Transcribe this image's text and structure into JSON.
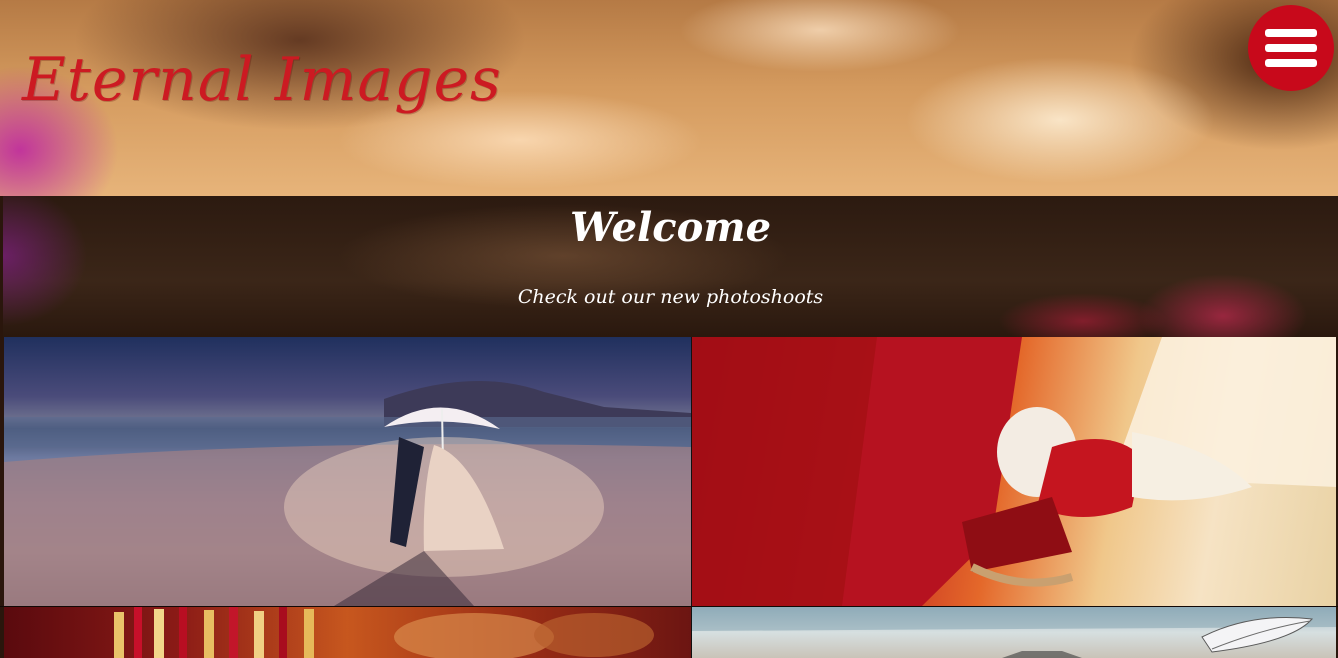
{
  "header": {
    "logo_text": "Eternal Images",
    "menu_icon": "hamburger-menu-icon",
    "menu_button_color": "#c8091b",
    "logo_color": "#cc1a22"
  },
  "welcome": {
    "title": "Welcome",
    "subtitle": "Check out our new photoshoots"
  },
  "gallery": {
    "photos": [
      {
        "subject": "couple under umbrella on beach at dusk"
      },
      {
        "subject": "wedding knot in red fabric"
      },
      {
        "subject": "bride's hands with bangles"
      },
      {
        "subject": "beach scene with feather"
      }
    ]
  }
}
